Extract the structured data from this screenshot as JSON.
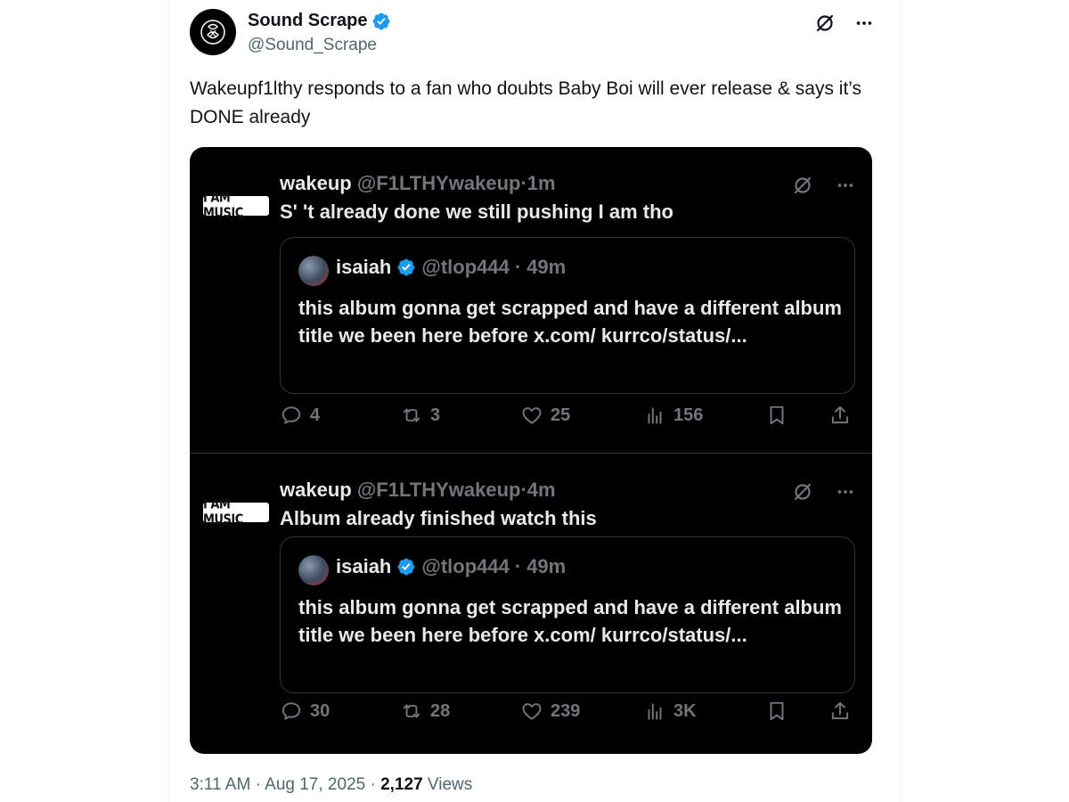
{
  "post": {
    "author_name": "Sound Scrape",
    "author_handle": "@Sound_Scrape",
    "text": "Wakeupf1lthy responds to a fan who doubts Baby Boi will ever release & says it’s DONE already",
    "time": "3:11 AM",
    "dot": "·",
    "date": "Aug 17, 2025",
    "views_count": "2,127",
    "views_label": "Views"
  },
  "embedded_tweets": [
    {
      "author_name": "wakeup",
      "author_handle": "@F1LTHYwakeup",
      "dot": "·",
      "time": "1m",
      "avatar_text": "I AM MUSIC",
      "text": "S' 't already done we still pushing I am tho",
      "quote": {
        "author_name": "isaiah",
        "author_handle": "@tlop444",
        "dot": "·",
        "time": "49m",
        "text": "this album gonna get scrapped and have a different album title we been here before x.com/ kurrco/status/..."
      },
      "stats": {
        "replies": "4",
        "reposts": "3",
        "likes": "25",
        "views": "156"
      }
    },
    {
      "author_name": "wakeup",
      "author_handle": "@F1LTHYwakeup",
      "dot": "·",
      "time": "4m",
      "avatar_text": "I AM MUSIC",
      "text": "Album already finished watch this",
      "quote": {
        "author_name": "isaiah",
        "author_handle": "@tlop444",
        "dot": "·",
        "time": "49m",
        "text": "this album gonna get scrapped and have a different album title we been here before x.com/ kurrco/status/..."
      },
      "stats": {
        "replies": "30",
        "reposts": "28",
        "likes": "239",
        "views": "3K"
      }
    }
  ],
  "colors": {
    "verified": "#1d9bf0",
    "text_dark": "#0f1419",
    "text_muted": "#536471",
    "embed_bg": "#000000",
    "embed_text": "#e7e9ea",
    "embed_muted": "#71767b"
  }
}
